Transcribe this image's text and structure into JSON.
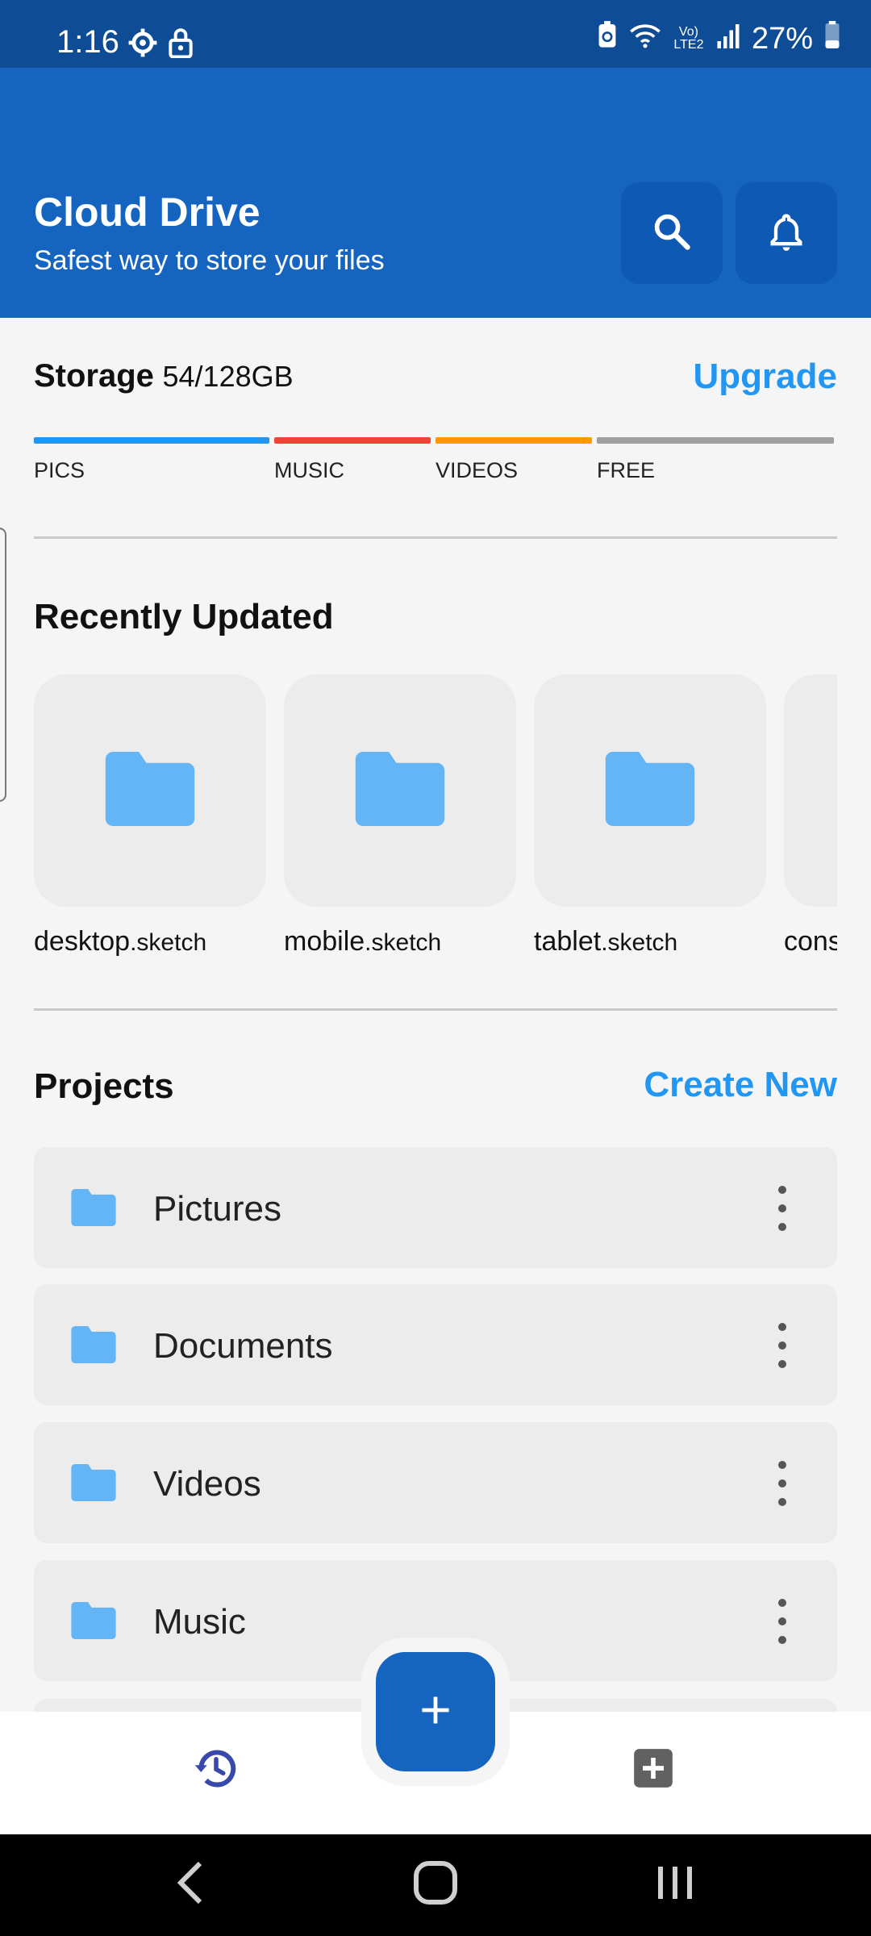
{
  "status_bar": {
    "time": "1:16",
    "battery": "27%",
    "icons": [
      "settings-gear-icon",
      "lock-icon",
      "battery-saver-icon",
      "wifi-icon",
      "volte-icon",
      "signal-icon",
      "battery-icon"
    ],
    "network_label": "Vo) LTE2"
  },
  "header": {
    "title": "Cloud Drive",
    "subtitle": "Safest way to store your files",
    "background": "#1565c0",
    "buttons": [
      {
        "icon": "search-icon"
      },
      {
        "icon": "bell-icon"
      }
    ]
  },
  "storage": {
    "label": "Storage",
    "value": "54/128GB",
    "upgrade_label": "Upgrade",
    "segments": [
      {
        "label": "PICS",
        "color": "#2196f3"
      },
      {
        "label": "MUSIC",
        "color": "#f44336"
      },
      {
        "label": "VIDEOS",
        "color": "#ff9800"
      },
      {
        "label": "FREE",
        "color": "#9e9e9e"
      }
    ]
  },
  "recent": {
    "title": "Recently Updated",
    "items": [
      {
        "name": "desktop",
        "ext": ".sketch"
      },
      {
        "name": "mobile",
        "ext": ".sketch"
      },
      {
        "name": "tablet",
        "ext": ".sketch"
      },
      {
        "name": "cons",
        "ext": ""
      }
    ]
  },
  "projects": {
    "title": "Projects",
    "create_label": "Create New",
    "items": [
      {
        "name": "Pictures"
      },
      {
        "name": "Documents"
      },
      {
        "name": "Videos"
      },
      {
        "name": "Music"
      }
    ]
  },
  "bottom_nav": {
    "fab_icon": "plus-icon",
    "left_icon": "history-icon",
    "right_icon": "add-box-icon"
  },
  "colors": {
    "accent": "#2196f3",
    "folder": "#64b5f6",
    "primary": "#1565c0"
  }
}
